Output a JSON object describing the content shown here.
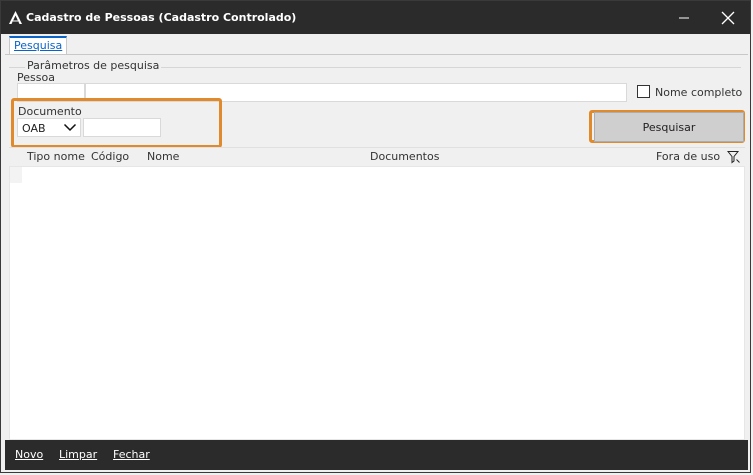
{
  "window": {
    "title": "Cadastro de Pessoas (Cadastro Controlado)"
  },
  "tabs": [
    {
      "label": "Pesquisa",
      "active": true
    }
  ],
  "search": {
    "group_label": "Parâmetros de pesquisa",
    "pessoa_label": "Pessoa",
    "pessoa_value": "",
    "nome_completo_label": "Nome completo",
    "nome_completo_checked": false,
    "documento_label": "Documento",
    "documento_type": "OAB",
    "documento_value": "",
    "search_button_label": "Pesquisar"
  },
  "grid": {
    "columns": [
      "Tipo nome",
      "Código",
      "Nome",
      "Documentos",
      "Fora de uso"
    ],
    "rows": []
  },
  "footer": {
    "novo": "Novo",
    "limpar": "Limpar",
    "fechar": "Fechar"
  },
  "colors": {
    "titlebar": "#2b2b2b",
    "highlight": "#e08a2c",
    "tab_accent": "#0a64c8"
  }
}
